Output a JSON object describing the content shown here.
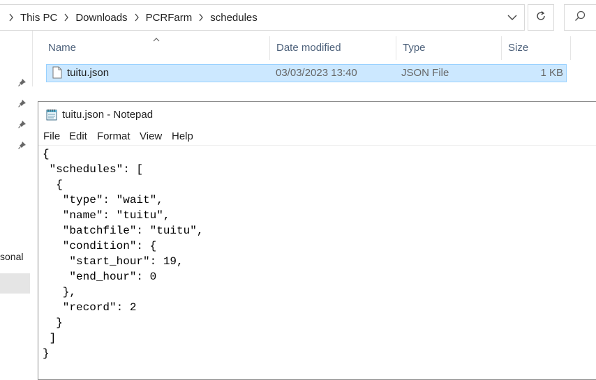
{
  "explorer": {
    "breadcrumbs": [
      "This PC",
      "Downloads",
      "PCRFarm",
      "schedules"
    ],
    "columns": {
      "name": "Name",
      "date_modified": "Date modified",
      "type": "Type",
      "size": "Size"
    },
    "files": [
      {
        "name": "tuitu.json",
        "date_modified": "03/03/2023 13:40",
        "type": "JSON File",
        "size": "1 KB",
        "selected": true
      }
    ],
    "nav_partial_label": "sonal",
    "pinned_item_count": 4
  },
  "notepad": {
    "title": "tuitu.json - Notepad",
    "menu": [
      "File",
      "Edit",
      "Format",
      "View",
      "Help"
    ],
    "content": "{\n \"schedules\": [\n  {\n   \"type\": \"wait\",\n   \"name\": \"tuitu\",\n   \"batchfile\": \"tuitu\",\n   \"condition\": {\n    \"start_hour\": 19,\n    \"end_hour\": 0\n   },\n   \"record\": 2\n  }\n ]\n}"
  },
  "icons": {
    "chevron": "chevron-right-icon",
    "dropdown": "chevron-down-icon",
    "refresh": "refresh-icon",
    "search": "search-icon",
    "pin": "pin-icon",
    "file": "file-icon",
    "notepad": "notepad-icon",
    "sort": "sort-ascending-icon"
  },
  "colors": {
    "selection_bg": "#cce8ff",
    "selection_border": "#99d1ff",
    "header_text": "#4c607a"
  }
}
